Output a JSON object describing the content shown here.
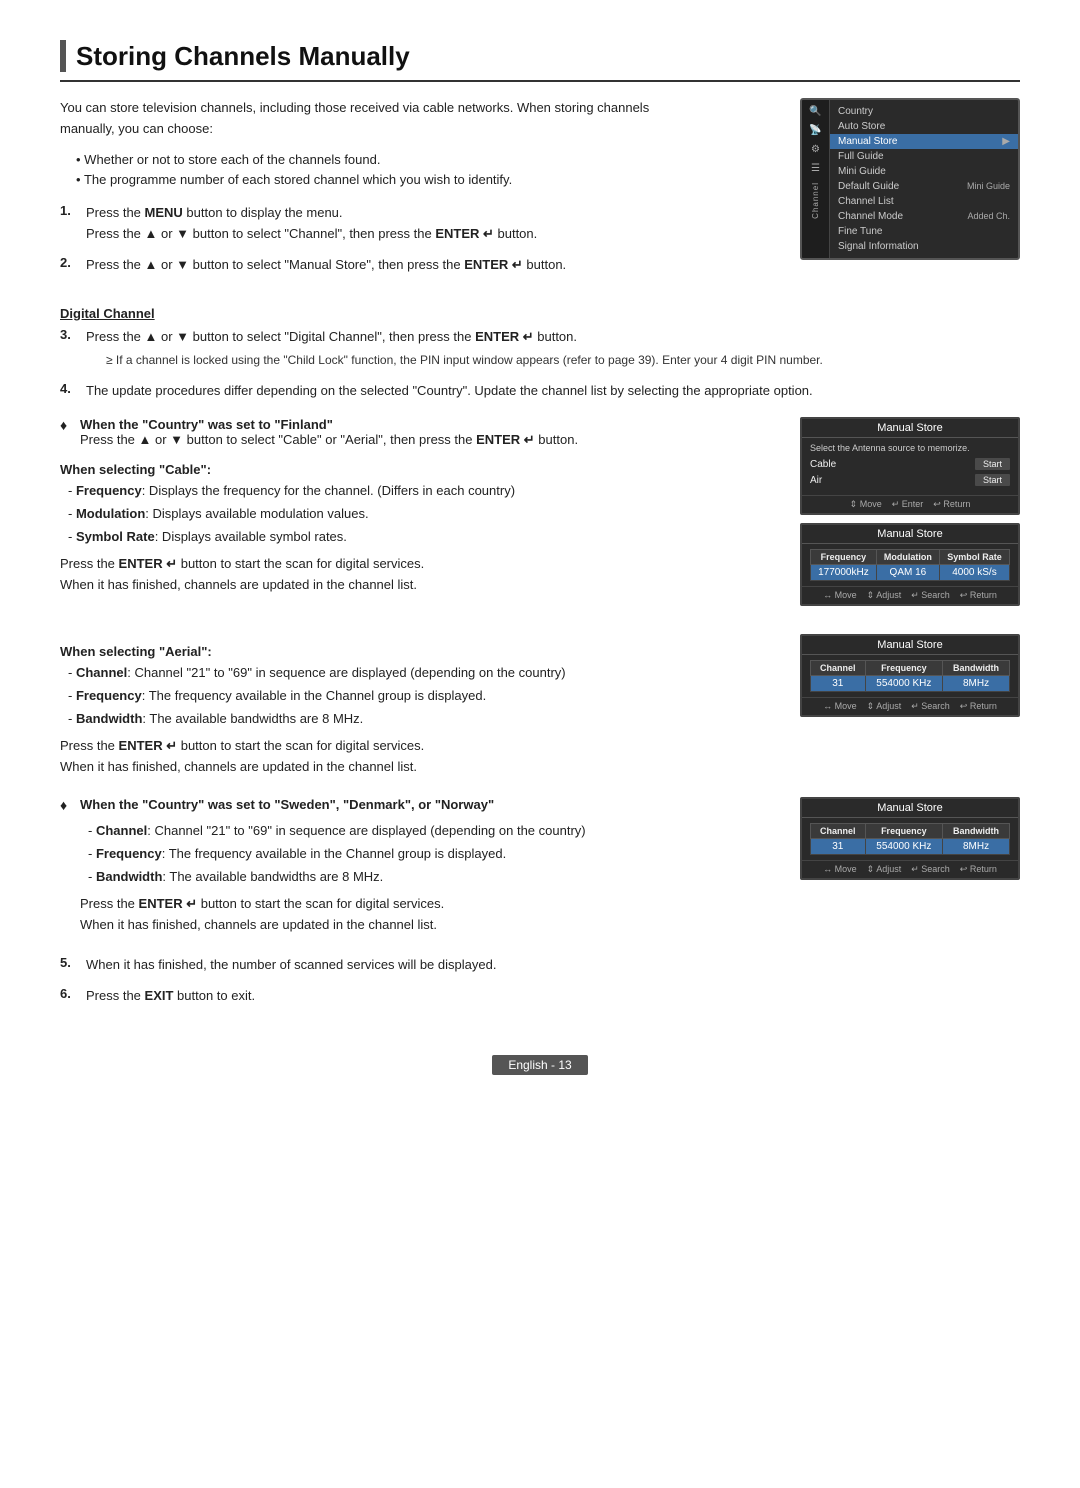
{
  "page": {
    "title": "Storing Channels Manually",
    "footer": "English - 13"
  },
  "intro": {
    "paragraph": "You can store television channels, including those received via cable networks. When storing channels manually, you can choose:",
    "bullets": [
      "Whether or not to store each of the channels found.",
      "The programme number of each stored channel which you wish to identify."
    ]
  },
  "steps": [
    {
      "num": "1.",
      "text": "Press the MENU button to display the menu. Press the ▲ or ▼ button to select \"Channel\", then press the ENTER ↵ button."
    },
    {
      "num": "2.",
      "text": "Press the ▲ or ▼ button to select \"Manual Store\", then press the ENTER ↵ button."
    }
  ],
  "channel_menu": {
    "title": "Channel",
    "items": [
      {
        "label": "Country",
        "value": "",
        "selected": false
      },
      {
        "label": "Auto Store",
        "value": "",
        "selected": false
      },
      {
        "label": "Manual Store",
        "value": "",
        "selected": true
      },
      {
        "label": "Full Guide",
        "value": "",
        "selected": false
      },
      {
        "label": "Mini Guide",
        "value": "",
        "selected": false
      },
      {
        "label": "Default Guide",
        "value": "Mini Guide",
        "selected": false
      },
      {
        "label": "Channel List",
        "value": "",
        "selected": false
      },
      {
        "label": "Channel Mode",
        "value": "Added Ch.",
        "selected": false
      },
      {
        "label": "Fine Tune",
        "value": "",
        "selected": false
      },
      {
        "label": "Signal Information",
        "value": "",
        "selected": false
      }
    ]
  },
  "digital_channel": {
    "heading": "Digital Channel",
    "step3": "Press the ▲ or ▼ button to select \"Digital Channel\", then press the ENTER ↵ button.",
    "note": "≥ If a channel is locked using the \"Child Lock\" function, the PIN input window appears (refer to page 39). Enter your 4 digit PIN number.",
    "step4": "The update procedures differ depending on the selected \"Country\". Update the channel list by selecting the appropriate option."
  },
  "finland_section": {
    "diamond": "♦",
    "heading": "When the \"Country\" was set to \"Finland\"",
    "text": "Press the ▲ or ▼ button to select \"Cable\" or \"Aerial\", then press the ENTER ↵ button."
  },
  "manual_store_1": {
    "title": "Manual Store",
    "desc": "Select the Antenna source to memorize.",
    "rows": [
      {
        "label": "Cable",
        "btn": "Start"
      },
      {
        "label": "Air",
        "btn": "Start"
      }
    ],
    "footer": [
      "⇕ Move",
      "↵ Enter",
      "↩ Return"
    ]
  },
  "cable_section": {
    "heading": "When selecting \"Cable\":",
    "items": [
      "Frequency: Displays the frequency for the channel. (Differs in each country)",
      "Modulation: Displays available modulation values.",
      "Symbol Rate: Displays available symbol rates."
    ],
    "text1": "Press the ENTER ↵ button to start the scan for digital services.",
    "text2": "When it has finished, channels are updated in the channel list."
  },
  "manual_store_2": {
    "title": "Manual Store",
    "columns": [
      "Frequency",
      "Modulation",
      "Symbol Rate"
    ],
    "values": [
      "177000kHz",
      "QAM 16",
      "4000 kS/s"
    ],
    "highlight_cols": [
      0,
      1,
      2
    ],
    "footer": [
      "↔ Move",
      "⇕ Adjust",
      "↵ Search",
      "↩ Return"
    ]
  },
  "aerial_section": {
    "heading": "When selecting \"Aerial\":",
    "items": [
      "Channel: Channel \"21\" to \"69\" in sequence are displayed (depending on the country)",
      "Frequency: The frequency available in the Channel group is displayed.",
      "Bandwidth: The available bandwidths are 8 MHz."
    ],
    "text1": "Press the ENTER ↵ button to start the scan for digital services.",
    "text2": "When it has finished, channels are updated in the channel list."
  },
  "manual_store_3": {
    "title": "Manual Store",
    "columns": [
      "Channel",
      "Frequency",
      "Bandwidth"
    ],
    "values": [
      "31",
      "554000 KHz",
      "8MHz"
    ],
    "highlight_cols": [
      0,
      1,
      2
    ],
    "footer": [
      "↔ Move",
      "⇕ Adjust",
      "↵ Search",
      "↩ Return"
    ]
  },
  "sweden_section": {
    "diamond": "♦",
    "heading": "When the \"Country\" was set to \"Sweden\", \"Denmark\", or \"Norway\"",
    "items": [
      "Channel: Channel \"21\" to \"69\" in sequence are displayed (depending on the country)",
      "Frequency: The frequency available in the Channel group is displayed.",
      "Bandwidth: The available bandwidths are 8 MHz."
    ],
    "text1": "Press the ENTER ↵ button to start the scan for digital services.",
    "text2": "When it has finished, channels are updated in the channel list."
  },
  "manual_store_4": {
    "title": "Manual Store",
    "columns": [
      "Channel",
      "Frequency",
      "Bandwidth"
    ],
    "values": [
      "31",
      "554000 KHz",
      "8MHz"
    ],
    "highlight_cols": [
      0,
      1,
      2
    ],
    "footer": [
      "↔ Move",
      "⇕ Adjust",
      "↵ Search",
      "↩ Return"
    ]
  },
  "final_steps": [
    {
      "num": "5.",
      "text": "When it has finished, the number of scanned services will be displayed."
    },
    {
      "num": "6.",
      "text": "Press the EXIT button to exit."
    }
  ]
}
